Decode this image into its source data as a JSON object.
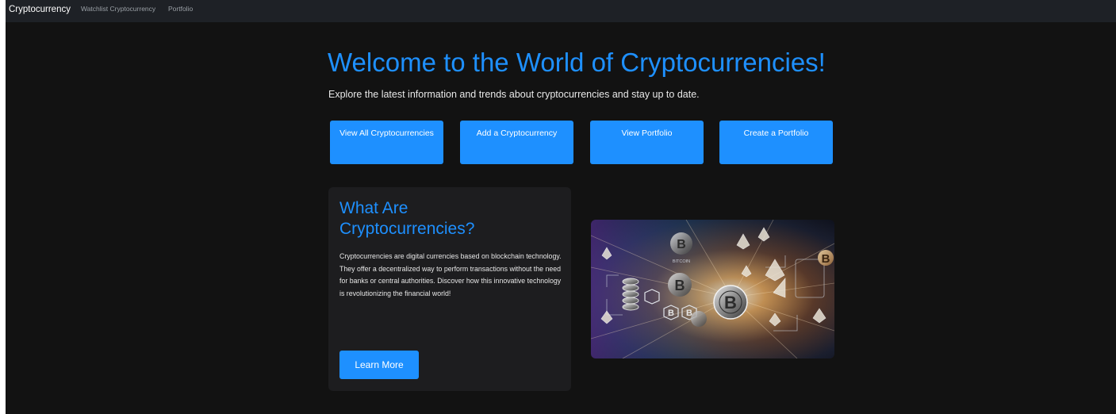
{
  "nav": {
    "brand": "Cryptocurrency",
    "links": [
      "Watchlist Cryptocurrency",
      "Portfolio"
    ]
  },
  "hero": {
    "title": "Welcome to the World of Cryptocurrencies!",
    "subtitle": "Explore the latest information and trends about cryptocurrencies and stay up to date."
  },
  "actions": [
    {
      "label": "View All Cryptocurrencies"
    },
    {
      "label": "Add a Cryptocurrency"
    },
    {
      "label": "View Portfolio"
    },
    {
      "label": "Create a Portfolio"
    }
  ],
  "info_card": {
    "title": "What Are Cryptocurrencies?",
    "body": "Cryptocurrencies are digital currencies based on blockchain technology. They offer a decentralized way to perform transactions without the need for banks or central authorities. Discover how this innovative technology is revolutionizing the financial world!",
    "button_label": "Learn More"
  },
  "image": {
    "coin_symbol": "B",
    "coin_caption": "BITCOIN"
  },
  "colors": {
    "accent": "#1e90ff",
    "background": "#121212",
    "navbar": "#1e2126",
    "card": "#1d1d1f"
  }
}
